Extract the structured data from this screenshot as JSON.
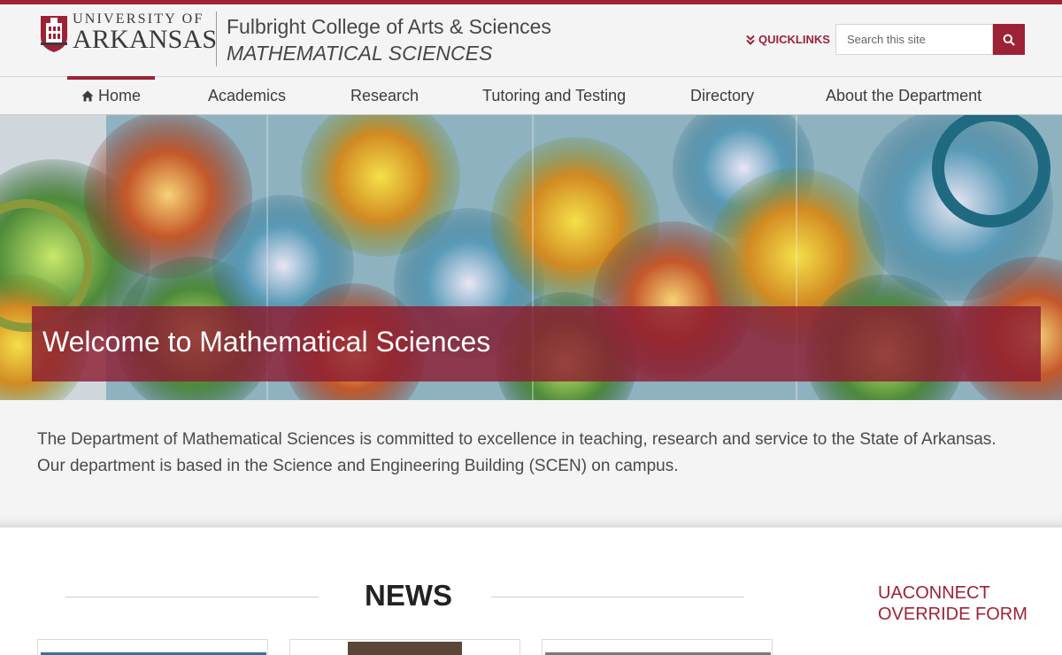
{
  "header": {
    "logo": {
      "line1": "UNIVERSITY OF",
      "line2": "ARKANSAS"
    },
    "college": "Fulbright College of Arts & Sciences",
    "department": "MATHEMATICAL SCIENCES",
    "quicklinks": "QUICKLINKS",
    "search_placeholder": "Search this site"
  },
  "nav": {
    "items": [
      {
        "label": "Home",
        "active": true
      },
      {
        "label": "Academics"
      },
      {
        "label": "Research"
      },
      {
        "label": "Tutoring and Testing"
      },
      {
        "label": "Directory"
      },
      {
        "label": "About the Department"
      }
    ]
  },
  "hero": {
    "title": "Welcome to Mathematical Sciences"
  },
  "intro": {
    "text": "The Department of Mathematical Sciences is committed to excellence in teaching, research and service to the State of Arkansas. Our department is based in the Science and Engineering Building (SCEN) on campus."
  },
  "news": {
    "heading": "NEWS"
  },
  "sidebar": {
    "uaconnect": "UACONNECT OVERRIDE FORM"
  },
  "colors": {
    "brand": "#9d2235",
    "background": "#f4f4f5"
  }
}
